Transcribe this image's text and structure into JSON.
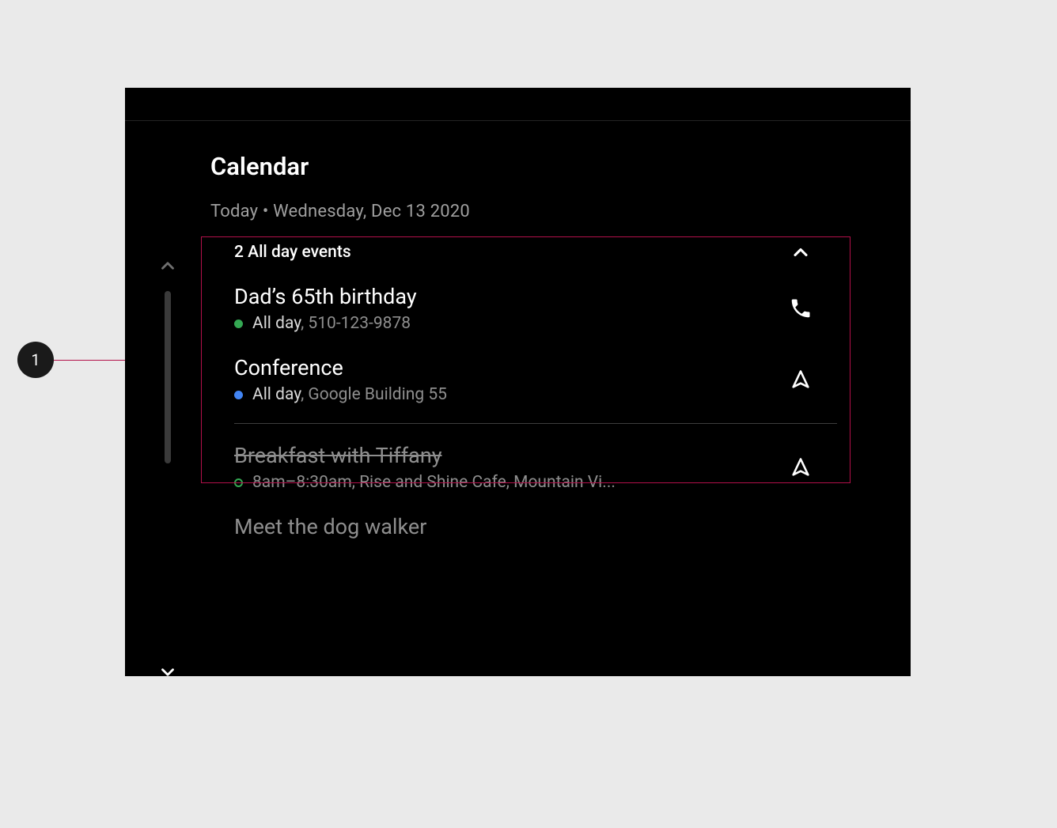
{
  "annotation": {
    "number": "1"
  },
  "app": {
    "title": "Calendar",
    "date_line": "Today • Wednesday, Dec 13 2020"
  },
  "allday_section": {
    "label": "2 All day events",
    "expanded": true
  },
  "events": [
    {
      "title": "Dad’s 65th birthday",
      "time": "All day",
      "location": "510-123-9878",
      "dot_color": "#34a853",
      "dot_style": "solid",
      "action_icon": "phone",
      "strikethrough": false,
      "dim": false
    },
    {
      "title": "Conference",
      "time": "All day",
      "location": "Google Building 55",
      "dot_color": "#4285f4",
      "dot_style": "solid",
      "action_icon": "navigate",
      "strikethrough": false,
      "dim": false
    },
    {
      "title": "Breakfast with Tiffany",
      "time": "8am–8:30am",
      "location": "Rise and Shine Cafe, Mountain Vi...",
      "dot_color": "#34a853",
      "dot_style": "outline",
      "action_icon": "navigate",
      "strikethrough": true,
      "dim": true
    },
    {
      "title": "Meet the dog walker",
      "time": "",
      "location": "",
      "dot_color": "",
      "dot_style": "none",
      "action_icon": "",
      "strikethrough": false,
      "dim": true
    }
  ]
}
